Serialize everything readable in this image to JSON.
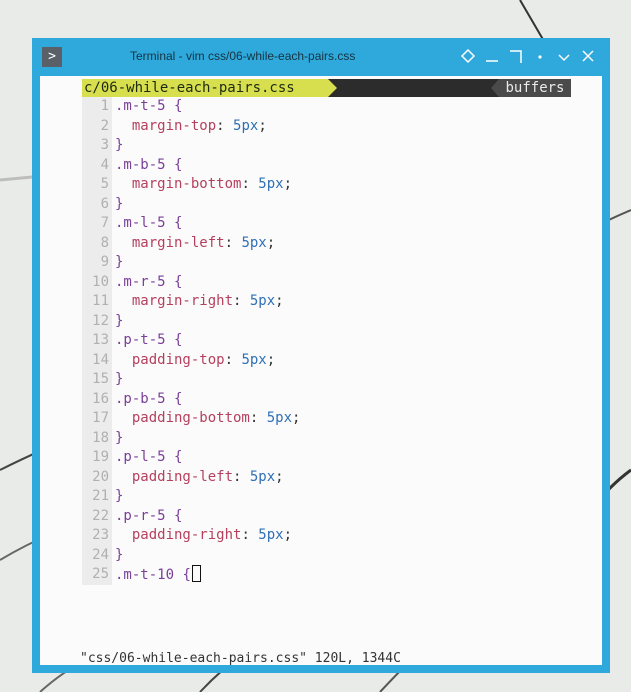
{
  "window": {
    "title": "Terminal - vim css/06-while-each-pairs.css",
    "app_icon_glyph": ">"
  },
  "controls": [
    {
      "name": "sticky-icon"
    },
    {
      "name": "minimize-icon"
    },
    {
      "name": "maximize-icon"
    },
    {
      "name": "menu-dot-icon"
    },
    {
      "name": "shade-icon"
    },
    {
      "name": "close-icon"
    }
  ],
  "tabline": {
    "file": "c/06-while-each-pairs.css",
    "buffers": "buffers"
  },
  "code_lines": [
    {
      "n": "1",
      "sel": ".m-t-5",
      "brace": " {"
    },
    {
      "n": "2",
      "prop": "margin-top",
      "val": "5px"
    },
    {
      "n": "3",
      "close": "}"
    },
    {
      "n": "4",
      "sel": ".m-b-5",
      "brace": " {"
    },
    {
      "n": "5",
      "prop": "margin-bottom",
      "val": "5px"
    },
    {
      "n": "6",
      "close": "}"
    },
    {
      "n": "7",
      "sel": ".m-l-5",
      "brace": " {"
    },
    {
      "n": "8",
      "prop": "margin-left",
      "val": "5px"
    },
    {
      "n": "9",
      "close": "}"
    },
    {
      "n": "10",
      "sel": ".m-r-5",
      "brace": " {"
    },
    {
      "n": "11",
      "prop": "margin-right",
      "val": "5px"
    },
    {
      "n": "12",
      "close": "}"
    },
    {
      "n": "13",
      "sel": ".p-t-5",
      "brace": " {"
    },
    {
      "n": "14",
      "prop": "padding-top",
      "val": "5px"
    },
    {
      "n": "15",
      "close": "}"
    },
    {
      "n": "16",
      "sel": ".p-b-5",
      "brace": " {"
    },
    {
      "n": "17",
      "prop": "padding-bottom",
      "val": "5px"
    },
    {
      "n": "18",
      "close": "}"
    },
    {
      "n": "19",
      "sel": ".p-l-5",
      "brace": " {"
    },
    {
      "n": "20",
      "prop": "padding-left",
      "val": "5px"
    },
    {
      "n": "21",
      "close": "}"
    },
    {
      "n": "22",
      "sel": ".p-r-5",
      "brace": " {"
    },
    {
      "n": "23",
      "prop": "padding-right",
      "val": "5px"
    },
    {
      "n": "24",
      "close": "}"
    },
    {
      "n": "25",
      "sel": ".m-t-10",
      "brace": " {",
      "cursor": true
    }
  ],
  "status_message": "\"css/06-while-each-pairs.css\" 120L, 1344C",
  "colors": {
    "frame": "#2fa9dc",
    "tab_active": "#d7df4e",
    "selector": "#7a3f99",
    "property": "#b4405e",
    "value": "#2f6fb5"
  }
}
